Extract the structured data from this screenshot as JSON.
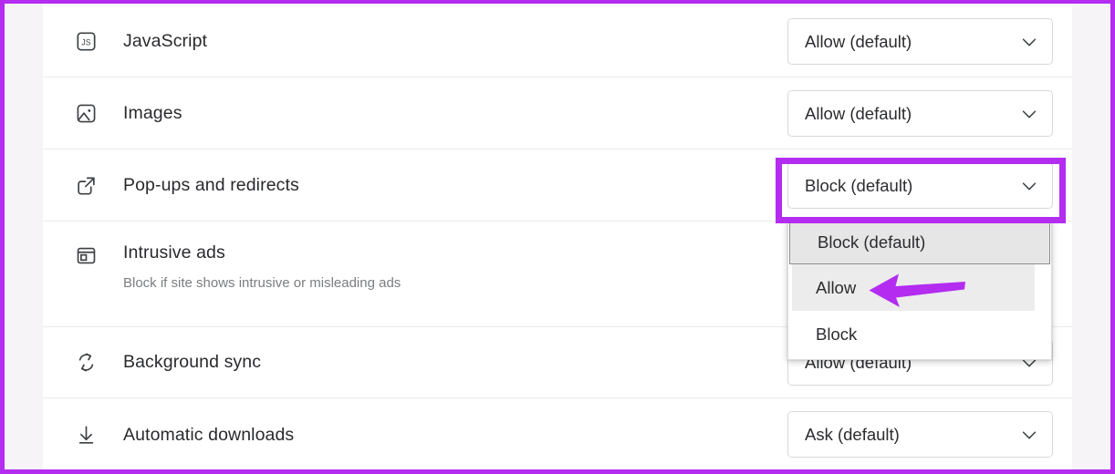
{
  "window": {
    "highlight_color": "#b32cf0",
    "background": "#f6f4f7",
    "card_background": "#ffffff"
  },
  "settings_rows": [
    {
      "icon": "javascript-icon",
      "title": "JavaScript",
      "subtitle": "",
      "control_value": "Allow (default)",
      "control_icon": "chevron-down-icon"
    },
    {
      "icon": "image-icon",
      "title": "Images",
      "subtitle": "",
      "control_value": "Allow (default)",
      "control_icon": "chevron-down-icon"
    },
    {
      "icon": "external-link-icon",
      "title": "Pop-ups and redirects",
      "subtitle": "",
      "control_value": "Block (default)",
      "control_icon": "chevron-down-icon"
    },
    {
      "icon": "ad-window-icon",
      "title": "Intrusive ads",
      "subtitle": "Block if site shows intrusive or misleading ads",
      "control_value": "",
      "control_icon": "chevron-down-icon"
    },
    {
      "icon": "sync-icon",
      "title": "Background sync",
      "subtitle": "",
      "control_value": "Allow (default)",
      "control_icon": "chevron-down-icon"
    },
    {
      "icon": "download-icon",
      "title": "Automatic downloads",
      "subtitle": "",
      "control_value": "Ask (default)",
      "control_icon": "chevron-down-icon"
    }
  ],
  "dropdown": {
    "open_for": "Pop-ups and redirects",
    "options": [
      {
        "label": "Block (default)",
        "state": "selected"
      },
      {
        "label": "Allow",
        "state": "hovered"
      },
      {
        "label": "Block",
        "state": "normal"
      }
    ]
  },
  "annotation": {
    "arrow": "left-pointing-arrow",
    "arrow_color": "#b32cf0",
    "points_at": "Allow"
  }
}
